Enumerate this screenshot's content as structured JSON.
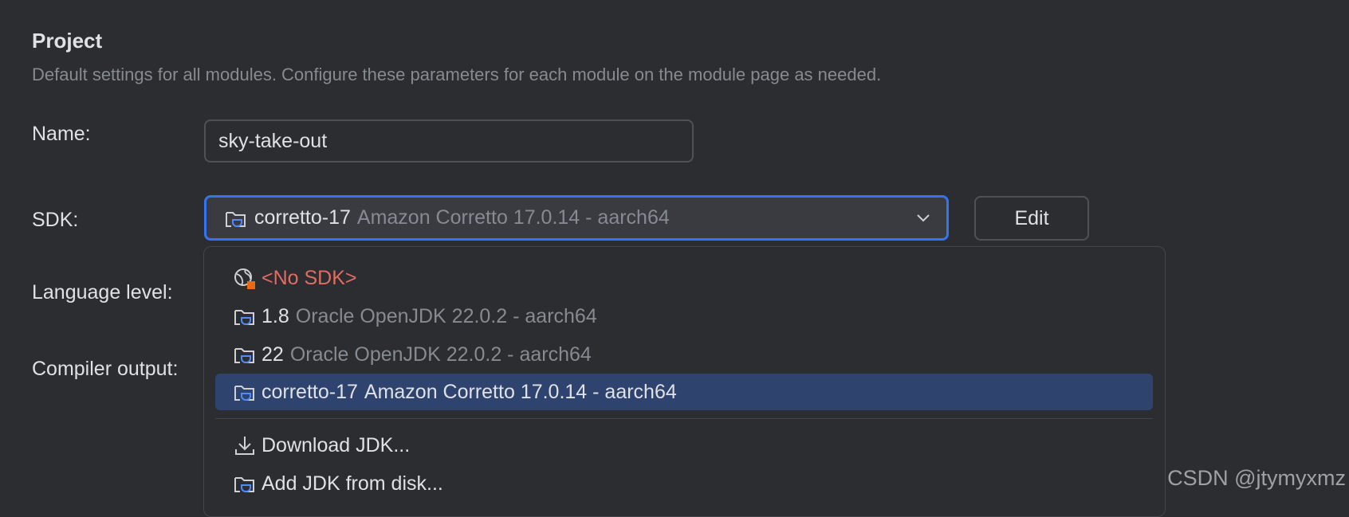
{
  "section": {
    "title": "Project",
    "subtitle": "Default settings for all modules. Configure these parameters for each module on the module page as needed."
  },
  "labels": {
    "name": "Name:",
    "sdk": "SDK:",
    "language_level": "Language level:",
    "compiler_output": "Compiler output:"
  },
  "name_field": {
    "value": "sky-take-out"
  },
  "sdk_combo": {
    "selected_name": "corretto-17",
    "selected_detail": "Amazon Corretto 17.0.14 - aarch64",
    "icon": "jdk-folder-icon"
  },
  "edit_button": {
    "label": "Edit"
  },
  "dropdown": {
    "items": [
      {
        "name": "<No SDK>",
        "detail": "",
        "icon": "no-sdk-globe-icon"
      },
      {
        "name": "1.8",
        "detail": "Oracle OpenJDK 22.0.2 - aarch64",
        "icon": "jdk-folder-icon"
      },
      {
        "name": "22",
        "detail": "Oracle OpenJDK 22.0.2 - aarch64",
        "icon": "jdk-folder-icon"
      },
      {
        "name": "corretto-17",
        "detail": "Amazon Corretto 17.0.14 - aarch64",
        "icon": "jdk-folder-icon",
        "selected": true
      }
    ],
    "actions": [
      {
        "label": "Download JDK...",
        "icon": "download-icon"
      },
      {
        "label": "Add JDK from disk...",
        "icon": "jdk-folder-icon"
      }
    ]
  },
  "watermark": "CSDN @jtymyxmz",
  "colors": {
    "background": "#2b2d30",
    "accent": "#3574f0",
    "selection": "#2e436e",
    "error_text": "#e06c63",
    "muted_text": "#868a91"
  }
}
